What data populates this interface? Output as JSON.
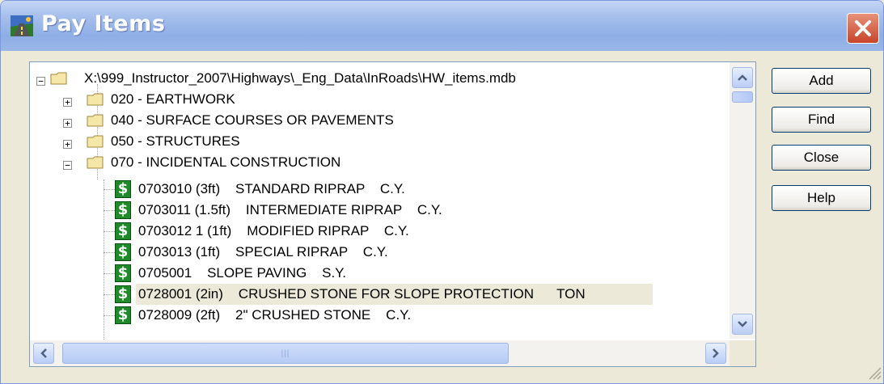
{
  "window": {
    "title": "Pay Items"
  },
  "tree": {
    "root_label": "X:\\999_Instructor_2007\\Highways\\_Eng_Data\\InRoads\\HW_items.mdb",
    "categories": [
      {
        "label": "020 - EARTHWORK",
        "expanded": false
      },
      {
        "label": "040 - SURFACE COURSES OR PAVEMENTS",
        "expanded": false
      },
      {
        "label": "050 - STRUCTURES",
        "expanded": false
      },
      {
        "label": "070 - INCIDENTAL CONSTRUCTION",
        "expanded": true
      }
    ],
    "items": [
      {
        "label": "0703010 (3ft)    STANDARD RIPRAP    C.Y."
      },
      {
        "label": "0703011 (1.5ft)    INTERMEDIATE RIPRAP    C.Y."
      },
      {
        "label": "0703012 1 (1ft)    MODIFIED RIPRAP    C.Y."
      },
      {
        "label": "0703013 (1ft)    SPECIAL RIPRAP    C.Y."
      },
      {
        "label": "0705001    SLOPE PAVING    S.Y."
      },
      {
        "label": "0728001 (2in)    CRUSHED STONE FOR SLOPE PROTECTION      TON",
        "selected": true
      },
      {
        "label": "0728009 (2ft)    2\" CRUSHED STONE    C.Y."
      }
    ]
  },
  "buttons": {
    "add": "Add",
    "find": "Find",
    "close": "Close",
    "help": "Help"
  },
  "icons": {
    "dollar_glyph": "$",
    "expanded_glyph": "−",
    "collapsed_glyph": "+",
    "scroll_grip": "|||"
  },
  "colors": {
    "titlebar": "#9bb6e8",
    "close_button": "#c7452a",
    "selection": "#ece9d8",
    "dollar_icon": "#1f8a2a"
  }
}
